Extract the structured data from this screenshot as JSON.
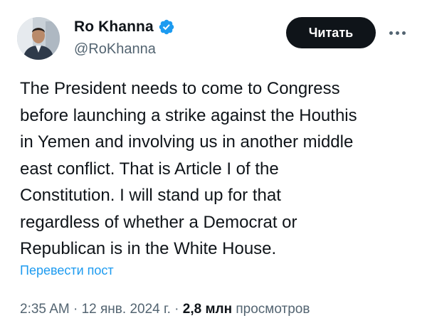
{
  "author": {
    "display_name": "Ro Khanna",
    "handle": "@RoKhanna",
    "avatar_icon": "profile-photo",
    "verified_icon": "verified-badge-icon",
    "verified_color": "#1d9bf0"
  },
  "actions": {
    "follow_label": "Читать",
    "more_icon": "more-options-icon"
  },
  "tweet": {
    "text": "The President needs to come to Congress\nbefore launching a strike against the Houthis\nin Yemen and involving us in another middle\neast conflict. That is Article I of the\nConstitution. I will stand up for that\nregardless of whether a Democrat or\nRepublican is in the White House.",
    "translate_label": "Перевести пост"
  },
  "meta": {
    "time": "2:35 AM",
    "separator": " · ",
    "date": "12 янв. 2024 г.",
    "views_count": "2,8 млн",
    "views_label": "просмотров"
  },
  "colors": {
    "text_primary": "#0f1419",
    "text_secondary": "#536471",
    "link": "#1d9bf0",
    "button_bg": "#0f1419"
  }
}
